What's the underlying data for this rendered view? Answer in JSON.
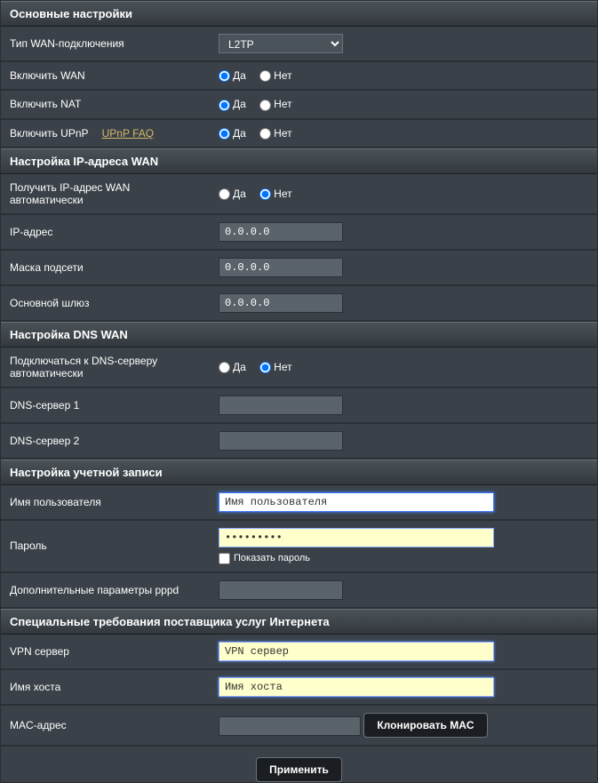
{
  "sections": {
    "basic": {
      "title": "Основные настройки",
      "wan_type_label": "Тип WAN-подключения",
      "wan_type_value": "L2TP",
      "enable_wan_label": "Включить WAN",
      "enable_nat_label": "Включить NAT",
      "enable_upnp_label": "Включить UPnP",
      "upnp_faq": "UPnP  FAQ"
    },
    "wan_ip": {
      "title": "Настройка IP-адреса WAN",
      "auto_ip_label": "Получить IP-адрес WAN автоматически",
      "ip_label": "IP-адрес",
      "ip_value": "0.0.0.0",
      "mask_label": "Маска подсети",
      "mask_value": "0.0.0.0",
      "gateway_label": "Основной шлюз",
      "gateway_value": "0.0.0.0"
    },
    "dns": {
      "title": "Настройка DNS WAN",
      "auto_dns_label": "Подключаться к DNS-серверу автоматически",
      "dns1_label": "DNS-сервер 1",
      "dns1_value": "",
      "dns2_label": "DNS-сервер 2",
      "dns2_value": ""
    },
    "account": {
      "title": "Настройка учетной записи",
      "username_label": "Имя пользователя",
      "username_value": "Имя пользователя",
      "password_label": "Пароль",
      "password_value": "•••••••••",
      "show_password": "Показать пароль",
      "pppd_label": "Дополнительные параметры pppd",
      "pppd_value": ""
    },
    "isp": {
      "title": "Специальные требования поставщика услуг Интернета",
      "vpn_label": "VPN сервер",
      "vpn_placeholder": "VPN сервер",
      "host_label": "Имя хоста",
      "host_placeholder": "Имя хоста",
      "mac_label": "MAC-адрес",
      "mac_value": "",
      "clone_mac": "Клонировать MAC"
    }
  },
  "radio": {
    "yes": "Да",
    "no": "Нет"
  },
  "apply": "Применить"
}
